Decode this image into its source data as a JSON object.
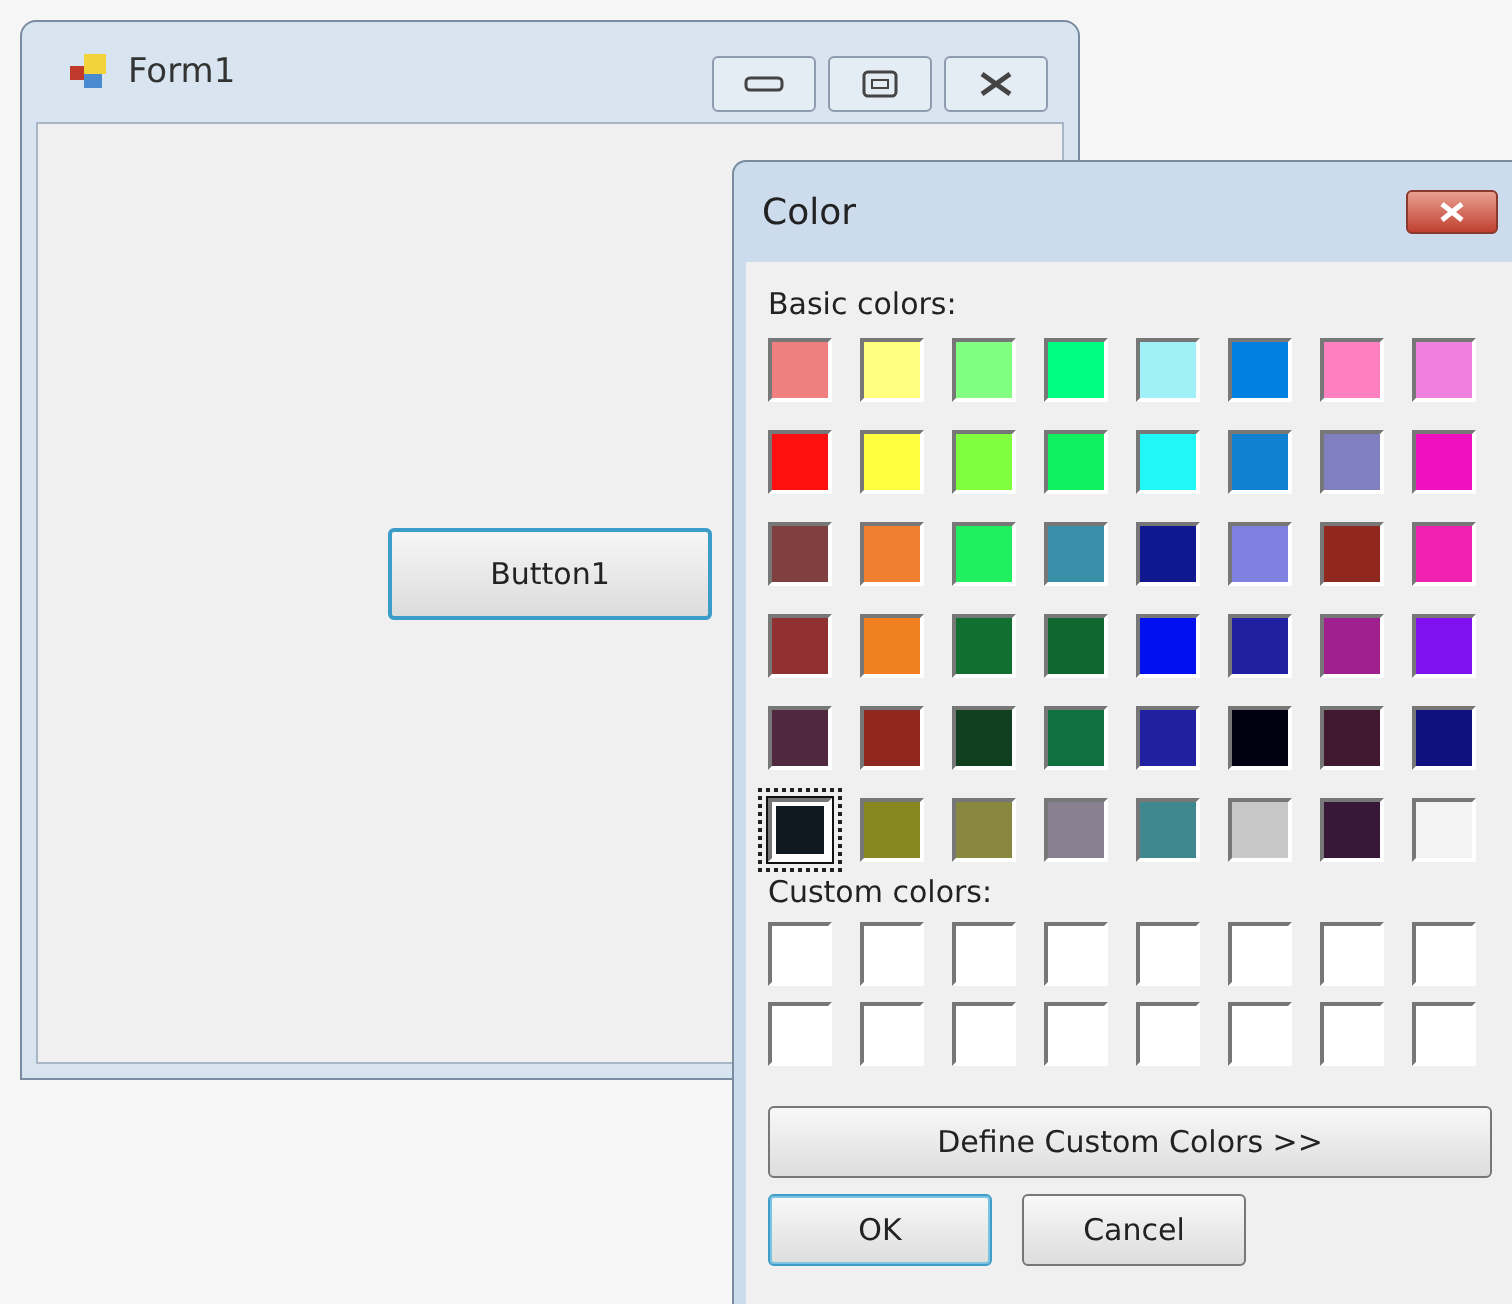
{
  "main_window": {
    "title": "Form1",
    "button": "Button1"
  },
  "color_dialog": {
    "title": "Color",
    "basic_colors_label": "Basic colors:",
    "basic_colors": [
      {
        "color": "#f08080",
        "selected": false
      },
      {
        "color": "#ffff80",
        "selected": false
      },
      {
        "color": "#80ff80",
        "selected": false
      },
      {
        "color": "#00ff80",
        "selected": false
      },
      {
        "color": "#a0f0f8",
        "selected": false
      },
      {
        "color": "#0080e0",
        "selected": false
      },
      {
        "color": "#ff80c0",
        "selected": false
      },
      {
        "color": "#f080e0",
        "selected": false
      },
      {
        "color": "#ff1010",
        "selected": false
      },
      {
        "color": "#ffff40",
        "selected": false
      },
      {
        "color": "#80ff40",
        "selected": false
      },
      {
        "color": "#10f060",
        "selected": false
      },
      {
        "color": "#20f8f8",
        "selected": false
      },
      {
        "color": "#1080d0",
        "selected": false
      },
      {
        "color": "#8080c0",
        "selected": false
      },
      {
        "color": "#f010c0",
        "selected": false
      },
      {
        "color": "#804040",
        "selected": false
      },
      {
        "color": "#f08030",
        "selected": false
      },
      {
        "color": "#20f060",
        "selected": false
      },
      {
        "color": "#3890a8",
        "selected": false
      },
      {
        "color": "#101890",
        "selected": false
      },
      {
        "color": "#8080e0",
        "selected": false
      },
      {
        "color": "#902820",
        "selected": false
      },
      {
        "color": "#f020b0",
        "selected": false
      },
      {
        "color": "#903030",
        "selected": false
      },
      {
        "color": "#f08020",
        "selected": false
      },
      {
        "color": "#107030",
        "selected": false
      },
      {
        "color": "#106830",
        "selected": false
      },
      {
        "color": "#0010f0",
        "selected": false
      },
      {
        "color": "#2020a0",
        "selected": false
      },
      {
        "color": "#a02090",
        "selected": false
      },
      {
        "color": "#8010f0",
        "selected": false
      },
      {
        "color": "#502840",
        "selected": false
      },
      {
        "color": "#902820",
        "selected": false
      },
      {
        "color": "#104020",
        "selected": false
      },
      {
        "color": "#107040",
        "selected": false
      },
      {
        "color": "#2020a0",
        "selected": false
      },
      {
        "color": "#000010",
        "selected": false
      },
      {
        "color": "#401830",
        "selected": false
      },
      {
        "color": "#101080",
        "selected": false
      },
      {
        "color": "#101820",
        "selected": true
      },
      {
        "color": "#888820",
        "selected": false
      },
      {
        "color": "#888840",
        "selected": false
      },
      {
        "color": "#888090",
        "selected": false
      },
      {
        "color": "#408890",
        "selected": false
      },
      {
        "color": "#c8c8c8",
        "selected": false
      },
      {
        "color": "#381838",
        "selected": false
      },
      {
        "color": "#f4f4f4",
        "selected": false
      }
    ],
    "custom_colors_label": "Custom colors:",
    "custom_colors": [
      {
        "color": "#ffffff"
      },
      {
        "color": "#ffffff"
      },
      {
        "color": "#ffffff"
      },
      {
        "color": "#ffffff"
      },
      {
        "color": "#ffffff"
      },
      {
        "color": "#ffffff"
      },
      {
        "color": "#ffffff"
      },
      {
        "color": "#ffffff"
      },
      {
        "color": "#ffffff"
      },
      {
        "color": "#ffffff"
      },
      {
        "color": "#ffffff"
      },
      {
        "color": "#ffffff"
      },
      {
        "color": "#ffffff"
      },
      {
        "color": "#ffffff"
      },
      {
        "color": "#ffffff"
      },
      {
        "color": "#ffffff"
      }
    ],
    "define_button": "Define Custom Colors >>",
    "ok_button": "OK",
    "cancel_button": "Cancel"
  }
}
